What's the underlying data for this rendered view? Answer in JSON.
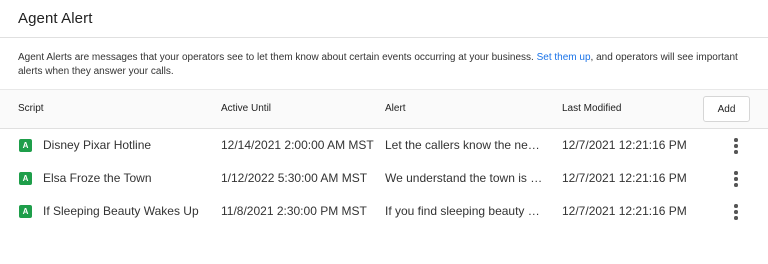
{
  "page": {
    "title": "Agent Alert",
    "description_before_link": "Agent Alerts are messages that your operators see to let them know about certain events occurring at your business. ",
    "description_link": "Set them up",
    "description_after_link": ", and operators will see important alerts when they answer your calls."
  },
  "table": {
    "headers": {
      "script": "Script",
      "active_until": "Active Until",
      "alert": "Alert",
      "last_modified": "Last Modified"
    },
    "add_label": "Add",
    "rows": [
      {
        "badge": "A",
        "script": "Disney Pixar Hotline",
        "active_until": "12/14/2021 2:00:00 AM MST",
        "alert": "Let the callers know the new ...",
        "last_modified": "12/7/2021 12:21:16 PM"
      },
      {
        "badge": "A",
        "script": "Elsa Froze the Town",
        "active_until": "1/12/2022 5:30:00 AM MST",
        "alert": "We understand the town is Fr...",
        "last_modified": "12/7/2021 12:21:16 PM"
      },
      {
        "badge": "A",
        "script": "If Sleeping Beauty Wakes Up",
        "active_until": "11/8/2021 2:30:00 PM MST",
        "alert": "If you find sleeping beauty aw...",
        "last_modified": "12/7/2021 12:21:16 PM"
      }
    ]
  },
  "colors": {
    "badge_green": "#1e9e4a",
    "link_blue": "#1a73e8"
  },
  "icons": {
    "row_menu": "more-vert-icon"
  }
}
